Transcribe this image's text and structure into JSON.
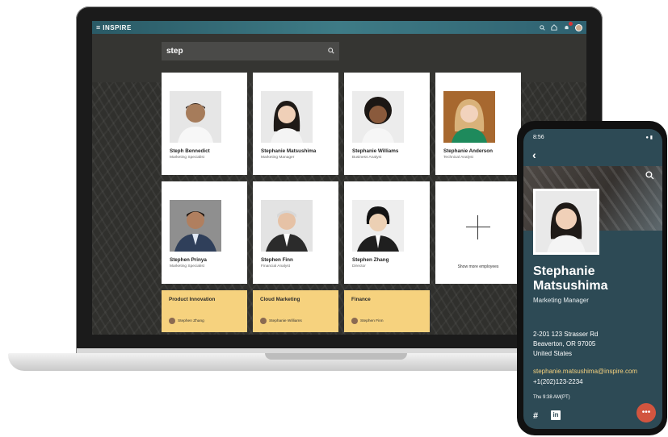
{
  "app": {
    "brand": "INSPIRE",
    "menu_icon": "hamburger-icon",
    "topbar_icons": [
      "search-icon",
      "home-icon",
      "bell-icon",
      "avatar"
    ]
  },
  "search": {
    "value": "step"
  },
  "people": [
    {
      "name": "Steph Bennedict",
      "title": "Marketing Specialist"
    },
    {
      "name": "Stephanie Matsushima",
      "title": "Marketing Manager"
    },
    {
      "name": "Stephanie Williams",
      "title": "Business Analyst"
    },
    {
      "name": "Stephanie Anderson",
      "title": "Technical Analyst"
    },
    {
      "name": "Stephen Prinya",
      "title": "Marketing Specialist"
    },
    {
      "name": "Stephen Finn",
      "title": "Financial Analyst"
    },
    {
      "name": "Stephen Zhang",
      "title": "Director"
    }
  ],
  "more": {
    "label": "Show more employees"
  },
  "teams": [
    {
      "name": "Product Innovation",
      "lead": "Stephen Zhang"
    },
    {
      "name": "Cloud Marketing",
      "lead": "Stephanie Williams"
    },
    {
      "name": "Finance",
      "lead": "Stephen Finn"
    }
  ],
  "phone": {
    "time": "8:56",
    "status_icons": "wifi-icon battery-icon",
    "name_first": "Stephanie",
    "name_last": "Matsushima",
    "role": "Marketing Manager",
    "address_line1": "2-201 123 Strasser Rd",
    "address_line2": "Beaverton, OR 97005",
    "address_line3": "United States",
    "email": "stephanie.matsushima@inspire.com",
    "phone": "+1(202)123-2234",
    "local_time": "Thu 9:38 AM(PT)"
  },
  "colors": {
    "accent": "#f6d27e",
    "topbar": "#3e7b86",
    "phone_bg": "#2d4a55",
    "chat": "#d2553f"
  }
}
